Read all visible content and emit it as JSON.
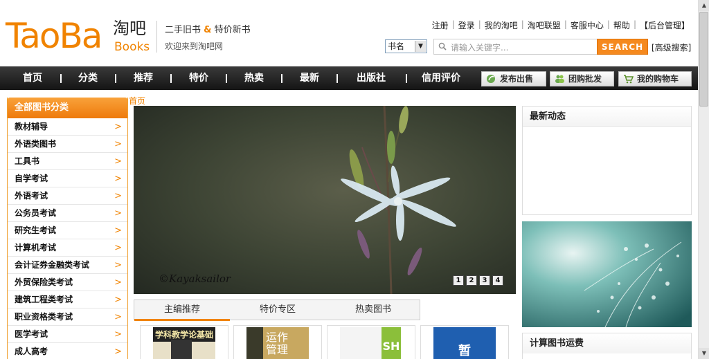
{
  "logo": {
    "text": "TaoBa",
    "cn": "淘吧",
    "books": "Books"
  },
  "header": {
    "slogan_a": "二手旧书",
    "slogan_amp": "&",
    "slogan_b": "特价新书",
    "welcome": "欢迎来到淘吧网"
  },
  "toplinks": [
    "注册",
    "登录",
    "我的淘吧",
    "淘吧联盟",
    "客服中心",
    "帮助",
    "【后台管理】"
  ],
  "search": {
    "select_value": "书名",
    "placeholder": "请输入关键字...",
    "button": "SEARCH",
    "advanced": "[高级搜索]"
  },
  "nav": [
    "首页",
    "分类",
    "推荐",
    "特价",
    "热卖",
    "最新",
    "出版社",
    "信用评价"
  ],
  "nav_buttons": [
    "发布出售",
    "团购批发",
    "我的购物车"
  ],
  "sidebar": {
    "title": "全部图书分类",
    "items": [
      "教材辅导",
      "外语类图书",
      "工具书",
      "自学考试",
      "外语考试",
      "公务员考试",
      "研究生考试",
      "计算机考试",
      "会计证券金融类考试",
      "外贸保险类考试",
      "建筑工程类考试",
      "职业资格类考试",
      "医学考试",
      "成人高考"
    ]
  },
  "breadcrumb": "首页",
  "banner": {
    "watermark": "©Kayaksailor",
    "pages": [
      "1",
      "2",
      "3",
      "4"
    ]
  },
  "tabs": [
    "主编推荐",
    "特价专区",
    "热卖图书"
  ],
  "books": [
    {
      "cover_text": "学科教学论基础"
    },
    {
      "cover_text": "运作管理"
    },
    {
      "cover_text": "SH"
    },
    {
      "cover_text": "暂"
    }
  ],
  "right": {
    "news_title": "最新动态",
    "calc_title": "计算图书运费"
  },
  "colors": {
    "accent": "#f08300",
    "nav_bg": "#1e1e1e"
  }
}
